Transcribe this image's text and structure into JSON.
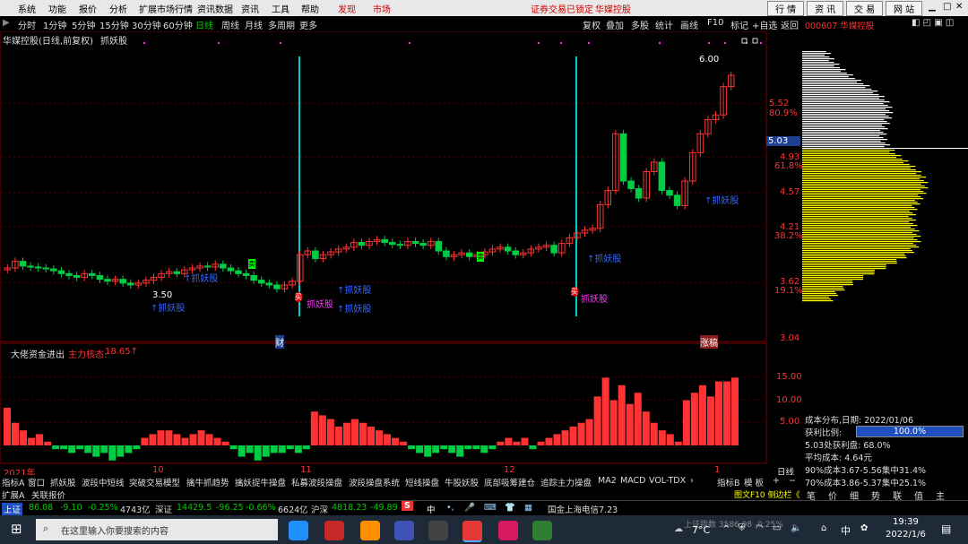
{
  "menu": {
    "items": [
      "系统",
      "功能",
      "报价",
      "分析",
      "扩展市场行情",
      "资讯数据",
      "资讯",
      "工具",
      "帮助"
    ],
    "discover": "发现",
    "market": "市场",
    "lock_notice": "证券交易已锁定",
    "stock_name_red": "华媒控股",
    "buttons": [
      "行 情",
      "资 讯",
      "交 易",
      "网 站"
    ]
  },
  "period": {
    "items": [
      "分时",
      "1分钟",
      "5分钟",
      "15分钟",
      "30分钟",
      "60分钟",
      "日线",
      "周线",
      "月线",
      "多周期",
      "更多"
    ],
    "selected": "日线",
    "right_items": [
      "复权",
      "叠加",
      "多股",
      "统计",
      "画线",
      "F10",
      "标记",
      "+自选",
      "返回"
    ]
  },
  "chart": {
    "title": "华媒控股(日线,前复权)",
    "indicator": "抓妖股",
    "price_high_label": "6.00",
    "price_low_label": "3.50",
    "current_price": "5.03",
    "y_labels": [
      {
        "v": "5.52",
        "p": "80.9%"
      },
      {
        "v": "4.93",
        "p": "61.8%"
      },
      {
        "v": "4.57",
        "p": ""
      },
      {
        "v": "4.21",
        "p": "38.2%"
      },
      {
        "v": "3.62",
        "p": "19.1%"
      },
      {
        "v": "3.04",
        "p": ""
      }
    ],
    "annotations": [
      "↑抓妖股",
      "↑抓妖股",
      "↑抓妖股",
      "↑抓妖股",
      "↑抓妖股",
      "↑抓妖股"
    ],
    "signal_labels": [
      "抓妖股",
      "抓妖股"
    ],
    "badge_cai": "财",
    "badge_zhangting": "涨稿",
    "buy_marks": [
      "买",
      "买"
    ],
    "sell_marks": [
      "卖",
      "卖"
    ]
  },
  "sub_chart": {
    "title": "大佬资金进出",
    "main_force_label": "主力核态:",
    "main_force_value": "18.65↑",
    "y_labels": [
      "15.00",
      "10.00",
      "5.00"
    ]
  },
  "x_axis": {
    "labels": [
      "2021年",
      "10",
      "11",
      "12",
      "1"
    ]
  },
  "right_panel": {
    "stock_code": "000607 华媒控股",
    "cost_date_label": "成本分布,日期:",
    "cost_date": "2022/01/06",
    "profit_ratio_label": "获利比例:",
    "profit_ratio": "100.0%",
    "profit_line": "5.03处获利盘: 68.0%",
    "avg_cost": "平均成本: 4.64元",
    "cost90": "90%成本3.67-5.56集中31.4%",
    "cost70": "70%成本3.86-5.37集中25.1%",
    "bottom_tabs": [
      "笔",
      "价",
      "细",
      "势",
      "联",
      "值",
      "主"
    ],
    "f10_label": "图文F10 侧边栏《",
    "day_label": "日线"
  },
  "tabs": {
    "items": [
      "指标A",
      "窗口",
      "抓妖股",
      "波段中短线",
      "突破交易模型",
      "擒牛抓趋势",
      "擒妖捉牛操盘",
      "私募波段操盘",
      "波段操盘系统",
      "短线操盘",
      "牛股妖股",
      "底部吸筹建仓",
      "追踪主力操盘",
      "MA2",
      "MACD",
      "VOL-TDX",
      "›",
      "指标B",
      "模 板",
      "+",
      "−"
    ],
    "row2": [
      "扩展A",
      "关联报价"
    ]
  },
  "status": {
    "sh_label": "上证",
    "sh_value": "86.08",
    "sh_change": "-9.10",
    "sh_pct": "-0.25%",
    "sh_amount": "4743亿",
    "sz_label": "深证",
    "sz_value": "14429.5",
    "sz_change": "-96.25",
    "sz_pct": "-0.66%",
    "sz_amount": "6624亿",
    "hs_label": "沪深",
    "hs_value": "4818.23",
    "hs_change": "-49.89",
    "news": "国金上海电信7.23"
  },
  "taskbar": {
    "search_placeholder": "在这里输入你要搜索的内容",
    "weather": "7°C",
    "ime": "中",
    "time": "19:39",
    "date": "2022/1/6",
    "index_ticker": "上证指数  3586.08  -0.25%"
  },
  "colors": {
    "up": "#ff3333",
    "down": "#00cc44",
    "cyan": "#00cccc",
    "yellow": "#ffff00"
  }
}
